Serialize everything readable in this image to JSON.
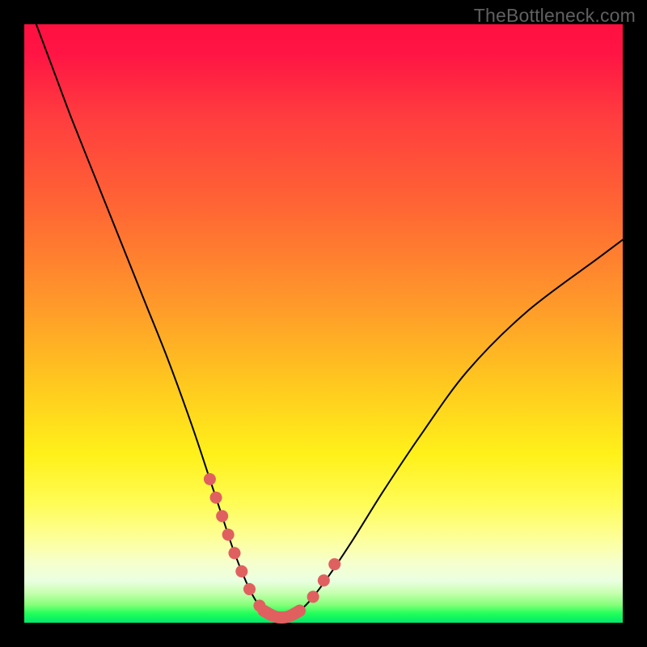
{
  "watermark": "TheBottleneck.com",
  "chart_data": {
    "type": "line",
    "title": "",
    "xlabel": "",
    "ylabel": "",
    "xlim": [
      0,
      100
    ],
    "ylim": [
      0,
      100
    ],
    "grid": false,
    "legend": false,
    "series": [
      {
        "name": "bottleneck-curve",
        "color": "#000000",
        "x": [
          2,
          5,
          8,
          12,
          16,
          20,
          24,
          28,
          31,
          33,
          35,
          37,
          38.5,
          40,
          42,
          44,
          46,
          48,
          51,
          55,
          60,
          66,
          74,
          84,
          96,
          100
        ],
        "y": [
          100,
          92,
          84,
          74,
          64,
          54,
          44,
          33,
          24,
          18,
          12,
          7,
          4,
          2,
          1,
          1,
          2,
          4,
          8,
          14,
          22,
          31,
          42,
          52,
          61,
          64
        ]
      },
      {
        "name": "highlight-left",
        "color": "#e06060",
        "style": "dotted-thick",
        "x": [
          31,
          33,
          35,
          37,
          38.5,
          40
        ],
        "y": [
          24,
          18,
          12,
          7,
          4,
          2
        ]
      },
      {
        "name": "highlight-bottom",
        "color": "#e06060",
        "style": "thick",
        "x": [
          40,
          42,
          44,
          46
        ],
        "y": [
          2,
          1,
          1,
          2
        ]
      },
      {
        "name": "highlight-right",
        "color": "#e06060",
        "style": "dotted-thick",
        "x": [
          46,
          48,
          50,
          52
        ],
        "y": [
          2,
          4,
          7,
          10
        ]
      }
    ],
    "annotations": []
  },
  "colors": {
    "background_frame": "#000000",
    "curve": "#000000",
    "highlight": "#e06060",
    "watermark": "#606060"
  }
}
